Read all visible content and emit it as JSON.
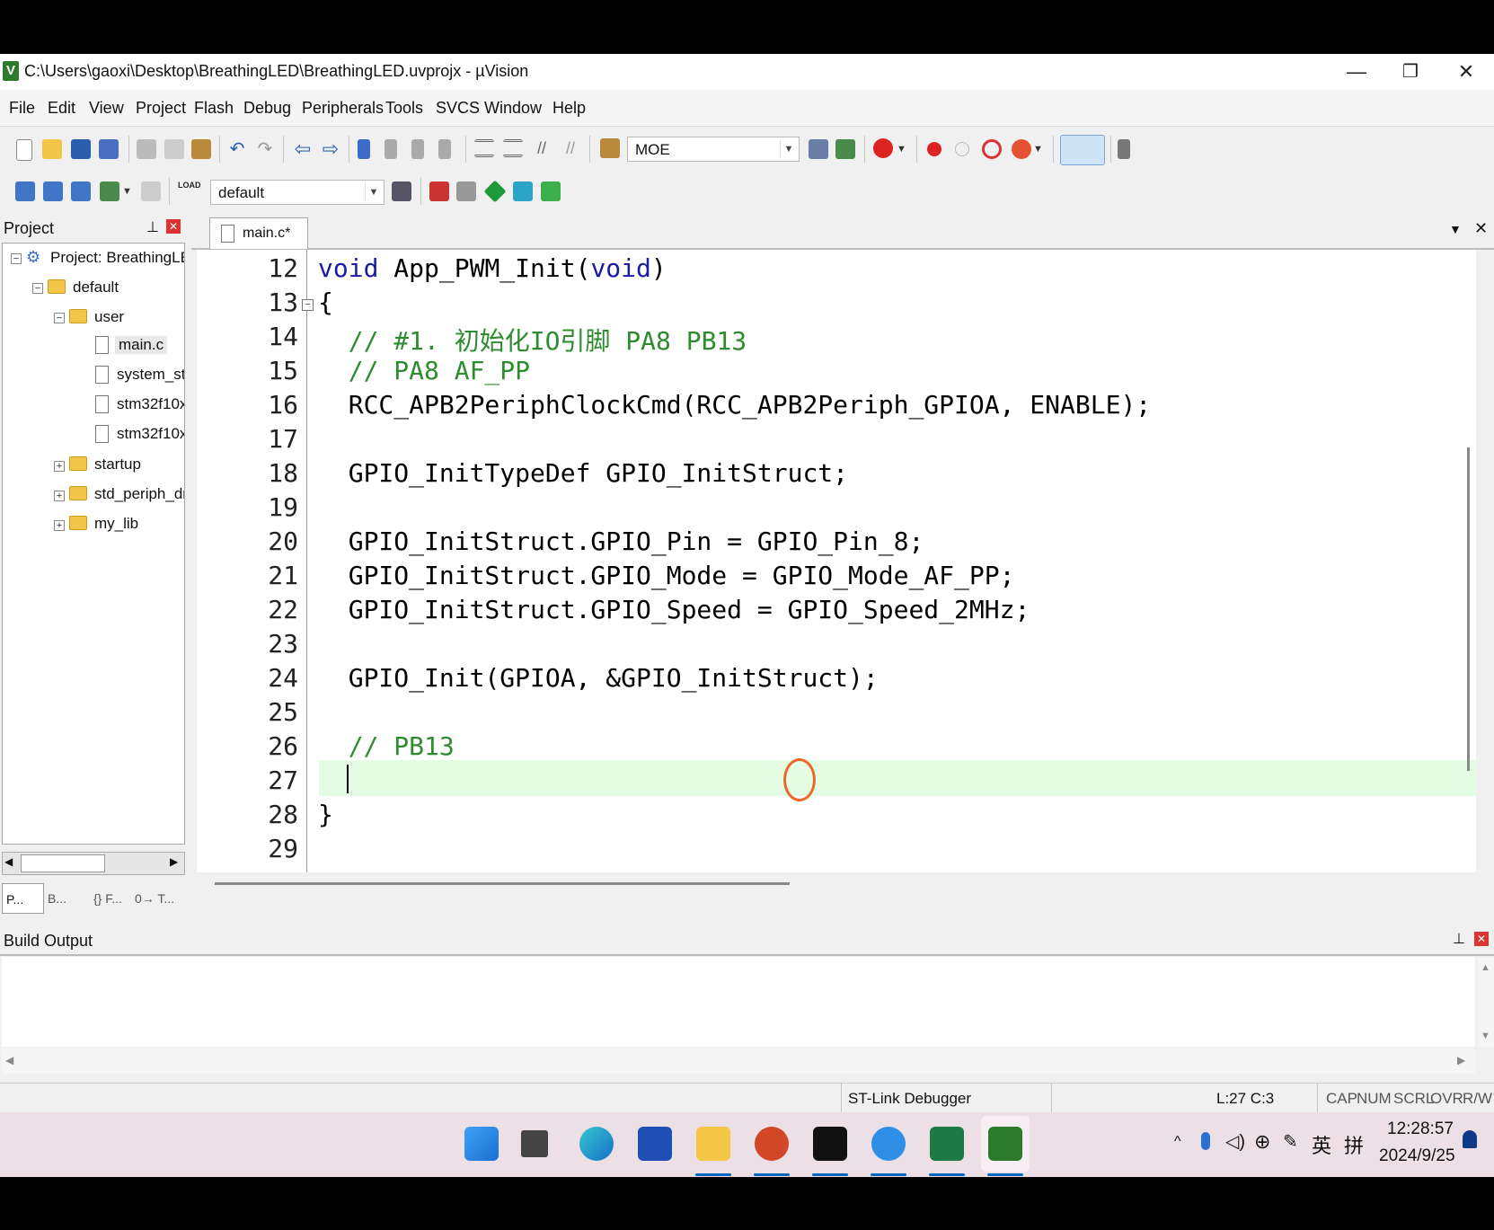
{
  "window": {
    "title": "C:\\Users\\gaoxi\\Desktop\\BreathingLED\\BreathingLED.uvprojx - µVision",
    "app_icon_letter": "V",
    "controls": {
      "minimize": "—",
      "restore": "❐",
      "close": "✕"
    }
  },
  "menu": [
    "File",
    "Edit",
    "View",
    "Project",
    "Flash",
    "Debug",
    "Peripherals",
    "Tools",
    "SVCS",
    "Window",
    "Help"
  ],
  "toolbar1": {
    "find_combo_value": "MOE"
  },
  "toolbar2": {
    "target_combo_value": "default",
    "load_label": "LOAD"
  },
  "project_panel": {
    "title": "Project",
    "tree": {
      "project": "Project: BreathingLED",
      "target": "default",
      "group_user": "user",
      "files": [
        "main.c",
        "system_st",
        "stm32f10x",
        "stm32f10x"
      ],
      "groups": [
        "startup",
        "std_periph_dr",
        "my_lib"
      ]
    },
    "bottom_tabs": [
      "P...",
      "B...",
      "{} F...",
      "0→ T..."
    ]
  },
  "editor": {
    "tab_label": "main.c*",
    "lines": [
      {
        "n": "12",
        "text": "void App_PWM_Init(void)"
      },
      {
        "n": "13",
        "text": "{"
      },
      {
        "n": "14",
        "text": "  // #1. 初始化IO引脚 PA8 PB13"
      },
      {
        "n": "15",
        "text": "  // PA8 AF_PP"
      },
      {
        "n": "16",
        "text": "  RCC_APB2PeriphClockCmd(RCC_APB2Periph_GPIOA, ENABLE);"
      },
      {
        "n": "17",
        "text": ""
      },
      {
        "n": "18",
        "text": "  GPIO_InitTypeDef GPIO_InitStruct;"
      },
      {
        "n": "19",
        "text": ""
      },
      {
        "n": "20",
        "text": "  GPIO_InitStruct.GPIO_Pin = GPIO_Pin_8;"
      },
      {
        "n": "21",
        "text": "  GPIO_InitStruct.GPIO_Mode = GPIO_Mode_AF_PP;"
      },
      {
        "n": "22",
        "text": "  GPIO_InitStruct.GPIO_Speed = GPIO_Speed_2MHz;"
      },
      {
        "n": "23",
        "text": ""
      },
      {
        "n": "24",
        "text": "  GPIO_Init(GPIOA, &GPIO_InitStruct);"
      },
      {
        "n": "25",
        "text": ""
      },
      {
        "n": "26",
        "text": "  // PB13"
      },
      {
        "n": "27",
        "text": ""
      },
      {
        "n": "28",
        "text": "}"
      },
      {
        "n": "29",
        "text": ""
      }
    ],
    "current_line": "27"
  },
  "build_output": {
    "title": "Build Output"
  },
  "status": {
    "debugger": "ST-Link Debugger",
    "position": "L:27 C:3",
    "indicators": [
      "CAP",
      "NUM",
      "SCRL",
      "OVR",
      "R/W"
    ]
  },
  "taskbar": {
    "tray": {
      "ime_lang": "英",
      "ime_mode": "拼",
      "chevron": "^"
    },
    "clock_time": "12:28:57",
    "clock_date": "2024/9/25"
  },
  "colors": {
    "keyword": "#1a1aa6",
    "comment": "#2e8b2e",
    "current_line_bg": "#e4fbe4",
    "cursor_marker": "#e86a2a",
    "taskbar_bg": "#ece0e6"
  }
}
